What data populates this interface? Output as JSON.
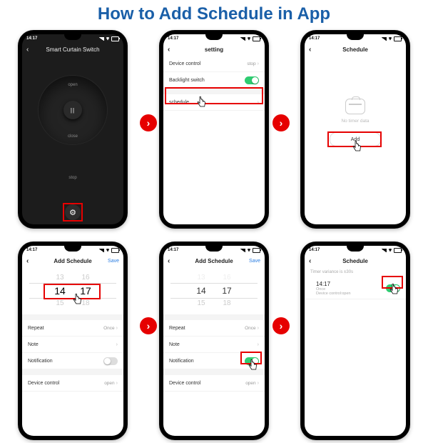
{
  "title": "How to Add Schedule in App",
  "status_time": "14:17",
  "phones": {
    "p1": {
      "header": "Smart Curtain Switch",
      "dial_top": "open",
      "dial_bottom": "close",
      "dial_center": "||",
      "stop": "stop"
    },
    "p2": {
      "header": "setting",
      "row1": "Device control",
      "row1_val": "stop",
      "row2": "Backlight switch",
      "row3": "schedule"
    },
    "p3": {
      "header": "Schedule",
      "empty": "No timer data",
      "add": "Add"
    },
    "p4": {
      "header": "Add Schedule",
      "save": "Save",
      "h_prev": "13",
      "h_sel": "14",
      "h_next": "15",
      "m_prev": "16",
      "m_sel": "17",
      "m_next": "18",
      "repeat": "Repeat",
      "repeat_val": "Once",
      "note": "Note",
      "notif": "Notification",
      "devctl": "Device control",
      "devctl_val": "open"
    },
    "p5": {
      "header": "Add Schedule",
      "save": "Save",
      "h_prev": "13",
      "h_sel": "14",
      "h_next": "15",
      "m_prev": "16",
      "m_sel": "17",
      "m_next": "18",
      "repeat": "Repeat",
      "repeat_val": "Once",
      "note": "Note",
      "notif": "Notification",
      "devctl": "Device control",
      "devctl_val": "open"
    },
    "p6": {
      "header": "Schedule",
      "variance": "Timer variance is  ±30s",
      "time": "14:17",
      "sub": "Once\nDevice control:open"
    }
  }
}
